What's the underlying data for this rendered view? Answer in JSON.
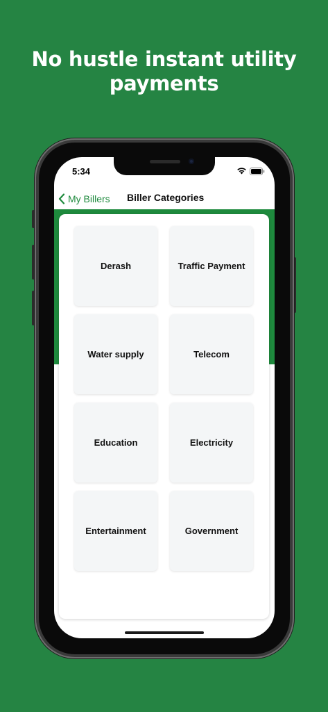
{
  "headline": {
    "line1": "No hustle instant utility",
    "line2": "payments"
  },
  "status_bar": {
    "time": "5:34",
    "wifi_icon": "wifi-icon",
    "battery_icon": "battery-icon"
  },
  "nav": {
    "back_label": "My Billers",
    "back_icon": "chevron-left-icon",
    "title": "Biller Categories"
  },
  "categories": [
    {
      "label": "Derash"
    },
    {
      "label": "Traffic Payment"
    },
    {
      "label": "Water supply"
    },
    {
      "label": "Telecom"
    },
    {
      "label": "Education"
    },
    {
      "label": "Electricity"
    },
    {
      "label": "Entertainment"
    },
    {
      "label": "Government"
    }
  ],
  "colors": {
    "background": "#258443",
    "accent": "#1e8a3d",
    "tile": "#f4f6f7"
  }
}
